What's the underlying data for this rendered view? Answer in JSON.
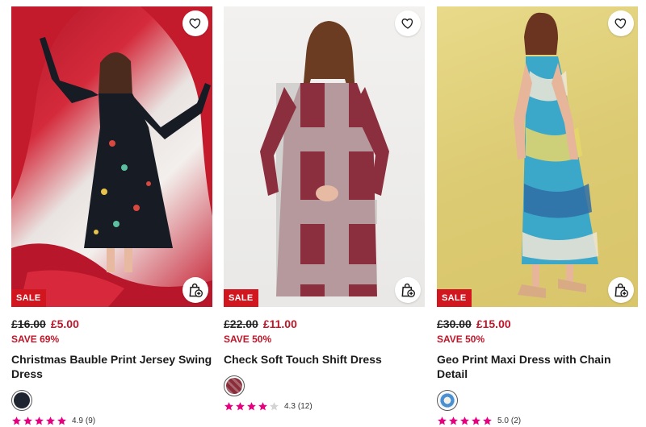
{
  "products": [
    {
      "badge": "SALE",
      "was_price": "£16.00",
      "now_price": "£5.00",
      "save": "SAVE 69%",
      "title": "Christmas Bauble Print Jersey Swing Dress",
      "swatch_color": "#1e2430",
      "rating": 4.9,
      "rating_value": "4.9",
      "review_count": "(9)",
      "stars_filled": 5
    },
    {
      "badge": "SALE",
      "was_price": "£22.00",
      "now_price": "£11.00",
      "save": "SAVE 50%",
      "title": "Check Soft Touch Shift Dress",
      "swatch_color": "#8a2d3a",
      "rating": 4.3,
      "rating_value": "4.3",
      "review_count": "(12)",
      "stars_filled": 4
    },
    {
      "badge": "SALE",
      "was_price": "£30.00",
      "now_price": "£15.00",
      "save": "SAVE 50%",
      "title": "Geo Print Maxi Dress with Chain Detail",
      "swatch_color": "#4a8fd0",
      "rating": 5.0,
      "rating_value": "5.0",
      "review_count": "(2)",
      "stars_filled": 5
    }
  ],
  "icons": {
    "wishlist": "heart-icon",
    "quick_add": "shopping-bag-plus-icon",
    "star": "star-icon"
  },
  "colors": {
    "sale_red": "#d1161f",
    "price_red": "#c0162a",
    "star_pink": "#e6007e"
  }
}
